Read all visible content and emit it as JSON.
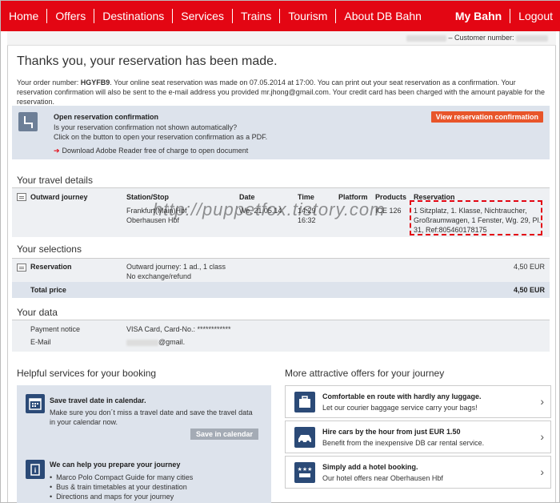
{
  "nav": {
    "items": [
      "Home",
      "Offers",
      "Destinations",
      "Services",
      "Trains",
      "Tourism",
      "About DB Bahn"
    ],
    "right": [
      "My Bahn",
      "Logout"
    ]
  },
  "customer": {
    "label": "– Customer number:"
  },
  "page": {
    "title": "Thanks you, your reservation has been made.",
    "order_prefix": "Your order number: ",
    "order_number": "HGYFB9",
    "order_text": ". Your online seat reservation was made on 07.05.2014 at 17:00. You can print out your seat reservation as a confirmation. Your reservation confirmation will also be sent to the e-mail address you provided mr.jhong@gmail.com. Your credit card has been charged with the amount payable for the reservation."
  },
  "confirm": {
    "heading": "Open reservation confirmation",
    "line1": "Is your reservation confirmation not shown automatically?",
    "line2": "Click on the button to open your reservation confirmation as a PDF.",
    "download": "Download Adobe Reader free of charge to open document",
    "button": "View reservation confirmation"
  },
  "travel": {
    "heading": "Your travel details",
    "journey_label": "Outward journey",
    "headers": {
      "station": "Station/Stop",
      "date": "Date",
      "time": "Time",
      "platform": "Platform",
      "products": "Products",
      "reservation": "Reservation"
    },
    "station_from": "Frankfurt(Main)Hbf",
    "station_to": "Oberhausen Hbf",
    "date": "We, 21.05.14",
    "time_dep": "14:29",
    "time_arr": "16:32",
    "product": "ICE 126",
    "reservation_text": "1 Sitzplatz, 1. Klasse, Nichtraucher, Großraumwagen, 1 Fenster, Wg. 29, Pl. 31, Ref:805460178175",
    "watermark": "http://puppetfox.tistory.com"
  },
  "selections": {
    "heading": "Your selections",
    "label": "Reservation",
    "desc1": "Outward journey: 1 ad., 1 class",
    "desc2": "No exchange/refund",
    "price": "4,50 EUR",
    "total_label": "Total price",
    "total_value": "4,50 EUR"
  },
  "yourdata": {
    "heading": "Your data",
    "payment_label": "Payment notice",
    "payment_value": "VISA Card, Card-No.: ************",
    "email_label": "E-Mail",
    "email_value": "@gmail."
  },
  "helpful": {
    "heading": "Helpful services for your booking",
    "calendar_heading": "Save travel date in calendar.",
    "calendar_text": "Make sure you don´t miss a travel date and save the travel data in your calendar now.",
    "calendar_button": "Save in calendar",
    "prepare_heading": "We can help you prepare your journey",
    "prepare_items": [
      "Marco Polo Compact Guide for many cities",
      "Bus & train timetables at your destination",
      "Directions and maps for your journey"
    ]
  },
  "offers": {
    "heading": "More attractive offers for your journey",
    "items": [
      {
        "title": "Comfortable en route with hardly any luggage.",
        "text": "Let our courier baggage service carry your bags!"
      },
      {
        "title": "Hire cars by the hour from just EUR 1.50",
        "text": "Benefit from the inexpensive DB car rental service."
      },
      {
        "title": "Simply add a hotel booking.",
        "text": "Our hotel offers near Oberhausen Hbf"
      }
    ]
  },
  "colors": {
    "brand_red": "#e30613",
    "panel_blue": "#dde3ec",
    "icon_blue": "#2b4a77",
    "button_orange": "#e8552a"
  }
}
